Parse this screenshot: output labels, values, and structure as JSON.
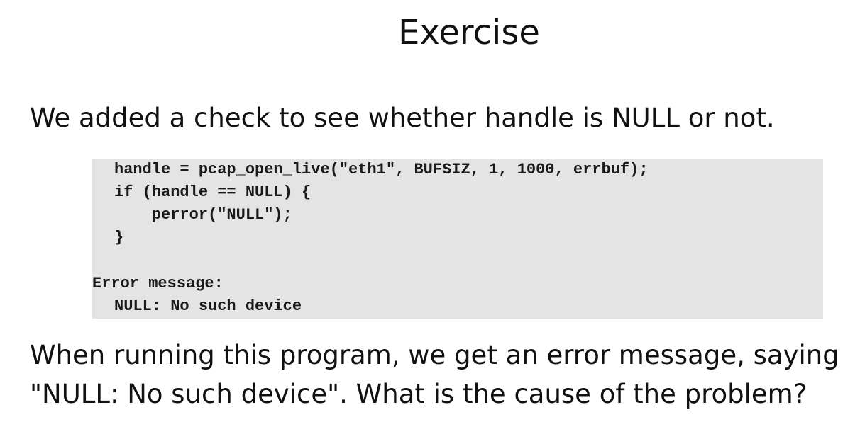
{
  "slide": {
    "title": "Exercise",
    "intro": "We added a check to see whether handle is NULL or not.",
    "code": [
      "handle = pcap_open_live(\"eth1\", BUFSIZ, 1, 1000, errbuf);",
      "if (handle == NULL) {",
      "    perror(\"NULL\");",
      "}"
    ],
    "error_label": "Error message:",
    "error_output": "NULL: No such device",
    "question_lines": [
      "When running this program, we get an error message, saying",
      "\"NULL: No such device\". What is the cause of the problem?"
    ]
  }
}
